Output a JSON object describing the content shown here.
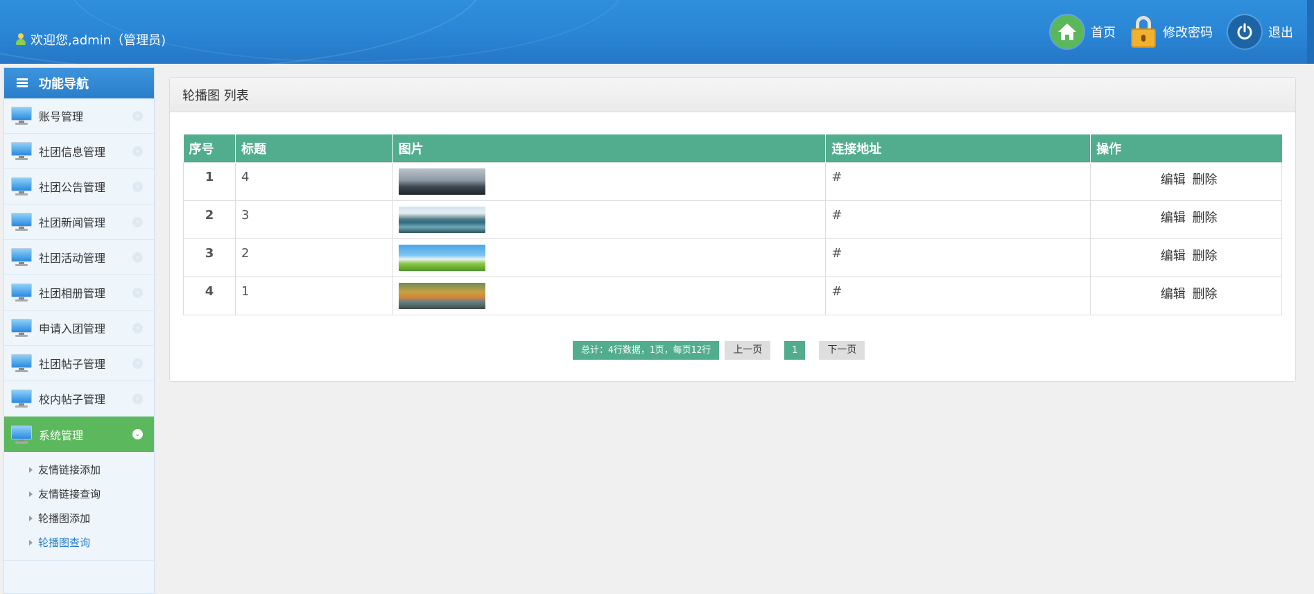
{
  "header": {
    "welcome": "欢迎您,admin（管理员)",
    "nav": [
      {
        "label": "首页",
        "icon": "home-icon"
      },
      {
        "label": "修改密码",
        "icon": "lock-icon"
      },
      {
        "label": "退出",
        "icon": "power-icon"
      }
    ]
  },
  "sidebar": {
    "title": "功能导航",
    "items": [
      {
        "label": "账号管理"
      },
      {
        "label": "社团信息管理"
      },
      {
        "label": "社团公告管理"
      },
      {
        "label": "社团新闻管理"
      },
      {
        "label": "社团活动管理"
      },
      {
        "label": "社团相册管理"
      },
      {
        "label": "申请入团管理"
      },
      {
        "label": "社团帖子管理"
      },
      {
        "label": "校内帖子管理"
      },
      {
        "label": "系统管理"
      }
    ],
    "submenu": [
      {
        "label": "友情链接添加"
      },
      {
        "label": "友情链接查询"
      },
      {
        "label": "轮播图添加"
      },
      {
        "label": "轮播图查询"
      }
    ]
  },
  "main": {
    "panel_title": "轮播图 列表",
    "columns": [
      "序号",
      "标题",
      "图片",
      "连接地址",
      "操作"
    ],
    "rows": [
      {
        "num": "1",
        "title": "4",
        "link": "#",
        "edit": "编辑",
        "delete": "删除"
      },
      {
        "num": "2",
        "title": "3",
        "link": "#",
        "edit": "编辑",
        "delete": "删除"
      },
      {
        "num": "3",
        "title": "2",
        "link": "#",
        "edit": "编辑",
        "delete": "删除"
      },
      {
        "num": "4",
        "title": "1",
        "link": "#",
        "edit": "编辑",
        "delete": "删除"
      }
    ],
    "pager": {
      "total": "总计：4行数据，1页，每页12行",
      "prev": "上一页",
      "page": "1",
      "next": "下一页"
    }
  },
  "colors": {
    "header_blue": "#2a86d6",
    "table_header_green": "#52ad8f",
    "active_menu_green": "#5cb85c"
  }
}
